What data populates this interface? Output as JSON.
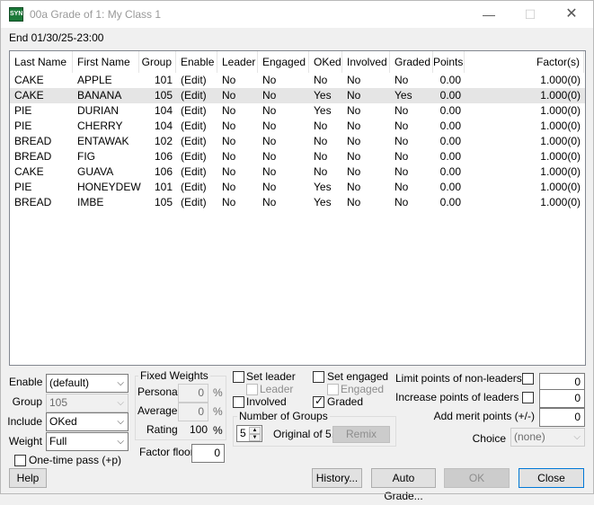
{
  "window": {
    "title": "00a Grade of 1: My Class 1",
    "icon_text": "SYN",
    "minimize_glyph": "—",
    "maximize_glyph": "☐",
    "close_glyph": "✕"
  },
  "end_label": "End 01/30/25-23:00",
  "table": {
    "columns": [
      "Last Name",
      "First Name",
      "Group",
      "Enable",
      "Leader",
      "Engaged",
      "OKed",
      "Involved",
      "Graded",
      "Points",
      "Factor(s)"
    ],
    "rows": [
      [
        "CAKE",
        "APPLE",
        "101",
        "(Edit)",
        "No",
        "No",
        "No",
        "No",
        "No",
        "0.00",
        "1.000(0)"
      ],
      [
        "CAKE",
        "BANANA",
        "105",
        "(Edit)",
        "No",
        "No",
        "Yes",
        "No",
        "Yes",
        "0.00",
        "1.000(0)"
      ],
      [
        "PIE",
        "DURIAN",
        "104",
        "(Edit)",
        "No",
        "No",
        "Yes",
        "No",
        "No",
        "0.00",
        "1.000(0)"
      ],
      [
        "PIE",
        "CHERRY",
        "104",
        "(Edit)",
        "No",
        "No",
        "No",
        "No",
        "No",
        "0.00",
        "1.000(0)"
      ],
      [
        "BREAD",
        "ENTAWAK",
        "102",
        "(Edit)",
        "No",
        "No",
        "No",
        "No",
        "No",
        "0.00",
        "1.000(0)"
      ],
      [
        "BREAD",
        "FIG",
        "106",
        "(Edit)",
        "No",
        "No",
        "No",
        "No",
        "No",
        "0.00",
        "1.000(0)"
      ],
      [
        "CAKE",
        "GUAVA",
        "106",
        "(Edit)",
        "No",
        "No",
        "No",
        "No",
        "No",
        "0.00",
        "1.000(0)"
      ],
      [
        "PIE",
        "HONEYDEW",
        "101",
        "(Edit)",
        "No",
        "No",
        "Yes",
        "No",
        "No",
        "0.00",
        "1.000(0)"
      ],
      [
        "BREAD",
        "IMBE",
        "105",
        "(Edit)",
        "No",
        "No",
        "Yes",
        "No",
        "No",
        "0.00",
        "1.000(0)"
      ]
    ],
    "selected_row": 1
  },
  "form": {
    "enable_label": "Enable",
    "enable_value": "(default)",
    "group_label": "Group",
    "group_value": "105",
    "include_label": "Include",
    "include_value": "OKed",
    "weight_label": "Weight",
    "weight_value": "Full",
    "one_time_pass_label": "One-time pass (+p)",
    "fixed_weights_title": "Fixed Weights",
    "personal_label": "Personal",
    "personal_value": "0",
    "average_label": "Average",
    "average_value": "0",
    "rating_label": "Rating",
    "rating_value": "100",
    "percent": "%",
    "factor_floor_label": "Factor floor",
    "factor_floor_value": "0",
    "set_leader_label": "Set leader",
    "leader_label": "Leader",
    "involved_label": "Involved",
    "set_engaged_label": "Set engaged",
    "engaged_label": "Engaged",
    "graded_label": "Graded",
    "graded_checked": true,
    "check_mark": "✓",
    "num_groups_title": "Number of Groups",
    "num_groups_value": "5",
    "original_label": "Original of 5.",
    "remix_label": "Remix",
    "limit_points_label": "Limit points of non-leaders to",
    "limit_points_value": "0",
    "increase_points_label": "Increase points of leaders by",
    "increase_points_value": "0",
    "add_merit_label": "Add merit points (+/-)",
    "add_merit_value": "0",
    "choice_label": "Choice",
    "choice_value": "(none)"
  },
  "buttons": {
    "help": "Help",
    "history": "History...",
    "auto_grade": "Auto Grade...",
    "ok": "OK",
    "close": "Close"
  }
}
